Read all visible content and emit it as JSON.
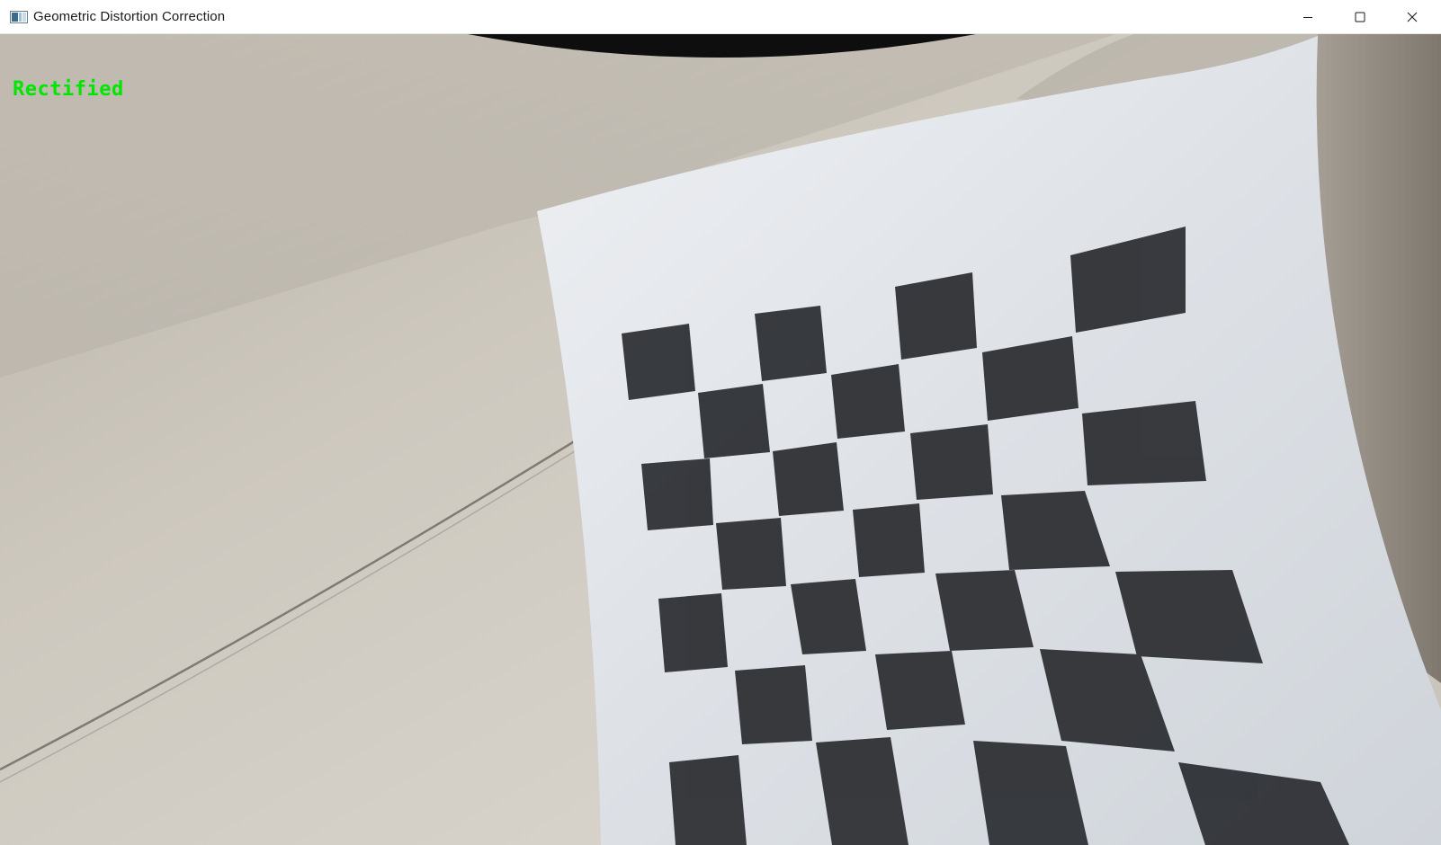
{
  "window": {
    "title": "Geometric Distortion Correction",
    "icon": "app-window-icon"
  },
  "controls": {
    "minimize_icon": "minimize-icon",
    "maximize_icon": "maximize-icon",
    "close_icon": "close-icon"
  },
  "video": {
    "overlay_label": "Rectified",
    "overlay_color": "#00e600",
    "scene": "camera-frame-checkerboard"
  },
  "colors": {
    "titlebar_bg": "#ffffff",
    "wall": "#c7c1b7",
    "paper": "#dfe3e8",
    "checker_dark": "#2a2c30"
  }
}
